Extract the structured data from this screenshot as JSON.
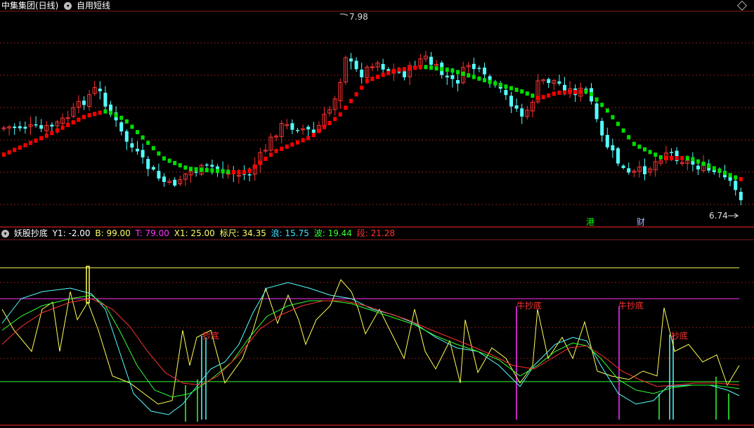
{
  "header": {
    "stock_title": "中集集团(日线)",
    "strategy_label": "自用短线",
    "max_label": "7.98",
    "min_label": "6.74",
    "events": [
      {
        "text": "港",
        "color": "#00ff00"
      },
      {
        "text": "财",
        "color": "#aab4ff"
      }
    ]
  },
  "indicator": {
    "name": "妖股抄底",
    "params": [
      {
        "text": "Y1: -2.00",
        "color": "#ffffff"
      },
      {
        "text": "B: 99.00",
        "color": "#ffff66"
      },
      {
        "text": "T: 79.00",
        "color": "#ff33ff"
      },
      {
        "text": "X1: 25.00",
        "color": "#ffff66"
      },
      {
        "text": "标尺: 34.35",
        "color": "#ffff66"
      },
      {
        "text": "浪: 15.75",
        "color": "#40e0ff"
      },
      {
        "text": "波: 19.44",
        "color": "#33ff33"
      },
      {
        "text": "段: 21.28",
        "color": "#ff3333"
      }
    ],
    "signals": [
      {
        "text": "抄底"
      },
      {
        "text": "牛抄底"
      },
      {
        "text": "牛抄底"
      },
      {
        "text": "抄底"
      }
    ]
  },
  "colors": {
    "up": "#ff3232",
    "down": "#54ffff",
    "ma_up": "#ff0000",
    "ma_down": "#00dd00",
    "grid": "#8b1a1a",
    "line_yellow": "#ffff55",
    "line_cyan": "#55ffff",
    "line_green": "#33ff33",
    "line_red": "#ff3030",
    "level_magenta": "#ff33ff",
    "level_green": "#33ff33"
  }
}
